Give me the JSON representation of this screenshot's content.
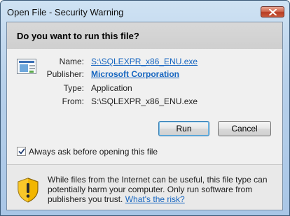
{
  "window": {
    "title": "Open File - Security Warning"
  },
  "dialog": {
    "question": "Do you want to run this file?",
    "fields": [
      {
        "label": "Name:",
        "value": "S:\\SQLEXPR_x86_ENU.exe"
      },
      {
        "label": "Publisher:",
        "value": "Microsoft Corporation"
      },
      {
        "label": "Type:",
        "value": "Application"
      },
      {
        "label": "From:",
        "value": "S:\\SQLEXPR_x86_ENU.exe"
      }
    ],
    "buttons": {
      "run": "Run",
      "cancel": "Cancel"
    },
    "checkbox": {
      "label": "Always ask before opening this file",
      "checked": true
    },
    "warning": {
      "text": "While files from the Internet can be useful, this file type can potentially harm your computer. Only run software from publishers you trust.",
      "link": "What's the risk?"
    }
  },
  "icons": {
    "close": "close-icon",
    "file": "application-file-icon",
    "warning": "warning-shield-icon",
    "check": "checkmark-icon"
  },
  "colors": {
    "link": "#1565c0",
    "shield_yellow": "#f2b600",
    "close_red": "#c85a3c"
  }
}
